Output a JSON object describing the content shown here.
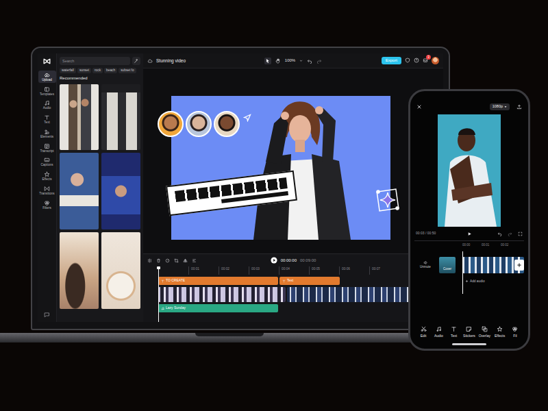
{
  "laptop": {
    "app_bar": {
      "items": [
        {
          "label": "Upload",
          "selected": true
        },
        {
          "label": "Templates",
          "selected": false
        },
        {
          "label": "Audio",
          "selected": false
        },
        {
          "label": "Text",
          "selected": false
        },
        {
          "label": "Elements",
          "selected": false
        },
        {
          "label": "Transcript",
          "selected": false
        },
        {
          "label": "Captions",
          "selected": false
        },
        {
          "label": "Effects",
          "selected": false
        },
        {
          "label": "Transitions",
          "selected": false
        },
        {
          "label": "Filters",
          "selected": false
        }
      ]
    },
    "assets": {
      "search": {
        "placeholder": "Search"
      },
      "tags": [
        "waterfall",
        "sunset",
        "rock",
        "beach",
        "subset fo"
      ],
      "section_title": "Recommended"
    },
    "header": {
      "title": "Stunning video",
      "zoom": "100%",
      "export": "Export",
      "badge": "3"
    },
    "timeline": {
      "current_time": "00:00:00",
      "total_time": "00:09:00",
      "ticks": [
        "00:01",
        "00:02",
        "00:03",
        "00:04",
        "00:05",
        "00:06",
        "00:07"
      ],
      "clips": [
        {
          "label": "TO CREATE",
          "kind": "text",
          "color": "#e27a2e"
        },
        {
          "label": "Text",
          "kind": "text",
          "color": "#e27a2e"
        },
        {
          "label": "Lazy Sunday",
          "kind": "audio",
          "color": "#2aa884"
        }
      ]
    }
  },
  "phone": {
    "resolution": "1080p",
    "time": "00:03 / 00:50",
    "ticks": [
      "00:00",
      "00:01",
      "00:02"
    ],
    "unmute": "Unmute",
    "cover": "Cover",
    "add_audio": "Add audio",
    "toolbar": [
      "Edit",
      "Audio",
      "Text",
      "Stickers",
      "Overlay",
      "Effects",
      "Fil"
    ]
  }
}
